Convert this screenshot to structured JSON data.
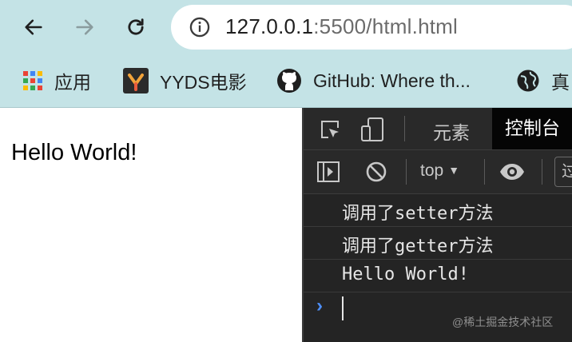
{
  "browser": {
    "url_host": "127.0.0.1",
    "url_rest": ":5500/html.html",
    "bookmarks": [
      {
        "label": "应用",
        "icon": "apps-grid-icon"
      },
      {
        "label": "YYDS电影",
        "icon": "yyds-logo-icon"
      },
      {
        "label": "GitHub: Where th...",
        "icon": "github-icon"
      },
      {
        "label": "真",
        "icon": "globe-icon"
      }
    ]
  },
  "page": {
    "text": "Hello World!"
  },
  "devtools": {
    "tabs": [
      {
        "label": "元素"
      },
      {
        "label": "控制台"
      }
    ],
    "context": "top",
    "filter_placeholder": "过",
    "logs": [
      "调用了setter方法",
      "调用了getter方法",
      "Hello World!"
    ],
    "prompt_symbol": "›"
  },
  "watermark": "@稀土掘金技术社区",
  "colors": {
    "chrome_bg": "#c4e3e6",
    "devtools_bg": "#242424",
    "prompt_blue": "#4d8ef7"
  }
}
